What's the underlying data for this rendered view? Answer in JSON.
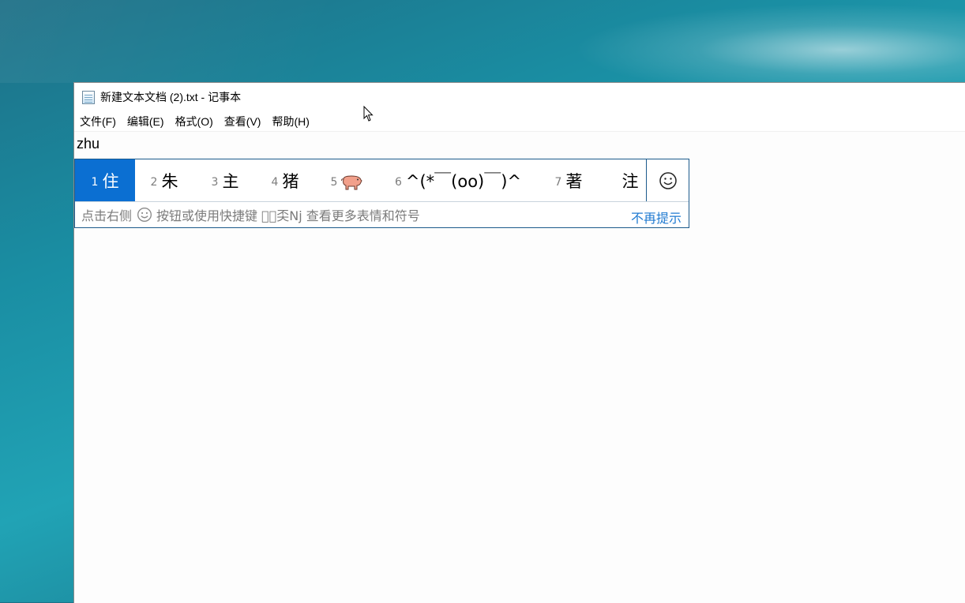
{
  "window": {
    "title": "新建文本文档 (2).txt - 记事本"
  },
  "menu": [
    {
      "label": "文件(F)"
    },
    {
      "label": "编辑(E)"
    },
    {
      "label": "格式(O)"
    },
    {
      "label": "查看(V)"
    },
    {
      "label": "帮助(H)"
    }
  ],
  "editor": {
    "content": "zhu"
  },
  "ime": {
    "candidates": [
      {
        "num": "1",
        "word": "住",
        "selected": true
      },
      {
        "num": "2",
        "word": "朱"
      },
      {
        "num": "3",
        "word": "主"
      },
      {
        "num": "4",
        "word": "猪"
      },
      {
        "num": "5",
        "word": "pig-emoji",
        "is_icon": true
      },
      {
        "num": "6",
        "word": "^(*￣(oo)￣)^"
      },
      {
        "num": "7",
        "word": "著"
      },
      {
        "num": "",
        "word": "注"
      }
    ],
    "hint_prefix": "点击右侧",
    "hint_suffix": "按钮或使用快捷键 \u0000奀Nj 查看更多表情和符号",
    "dismiss_label": "不再提示",
    "emoji_icon": "smiley-icon"
  },
  "colors": {
    "selected_bg": "#0b6fd2",
    "ime_border": "#1c5b8c",
    "link": "#1f7ad1"
  }
}
